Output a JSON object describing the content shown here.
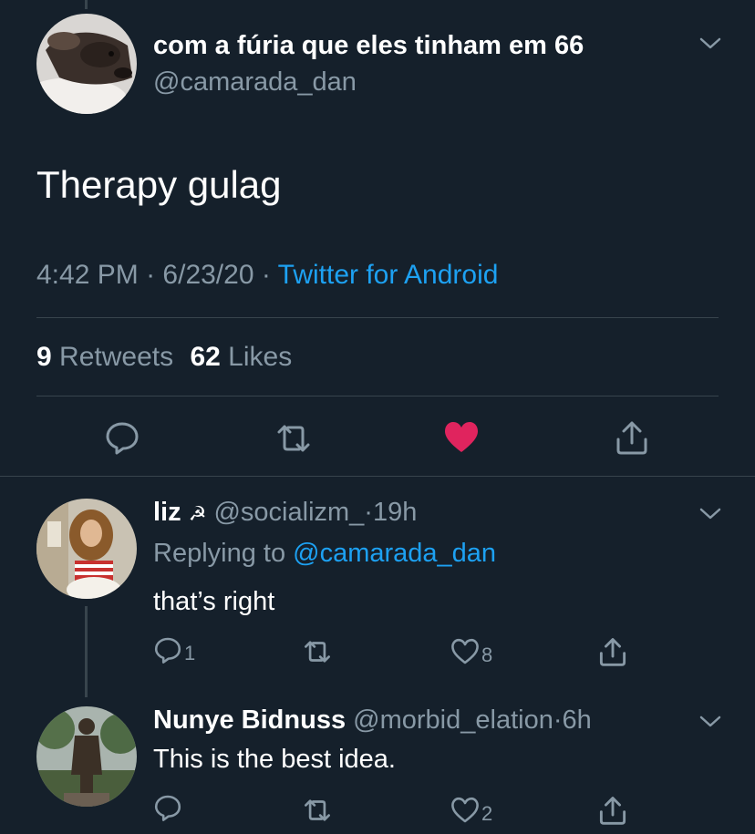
{
  "main_tweet": {
    "display_name": "com a fúria que eles tinham em 66",
    "handle": "@camarada_dan",
    "text": "Therapy gulag",
    "time": "4:42 PM",
    "date": "6/23/20",
    "source": "Twitter for Android",
    "retweet_count": "9",
    "retweet_label": "Retweets",
    "like_count": "62",
    "like_label": "Likes",
    "liked": true,
    "like_color": "#e0245e"
  },
  "replies": [
    {
      "display_name": "liz",
      "name_emoji": "☭",
      "handle": "@socializm_",
      "age": "19h",
      "replying_label": "Replying to",
      "replying_to": "@camarada_dan",
      "text": "that’s right",
      "reply_count": "1",
      "retweet_count": "",
      "like_count": "8"
    },
    {
      "display_name": "Nunye Bidnuss",
      "handle": "@morbid_elation",
      "age": "6h",
      "text": "This is the best idea.",
      "reply_count": "",
      "retweet_count": "",
      "like_count": "2"
    }
  ],
  "colors": {
    "background": "#15202b",
    "text": "#ffffff",
    "muted": "#8899a6",
    "link": "#1da1f2",
    "divider": "#38444d"
  },
  "separator": "·"
}
